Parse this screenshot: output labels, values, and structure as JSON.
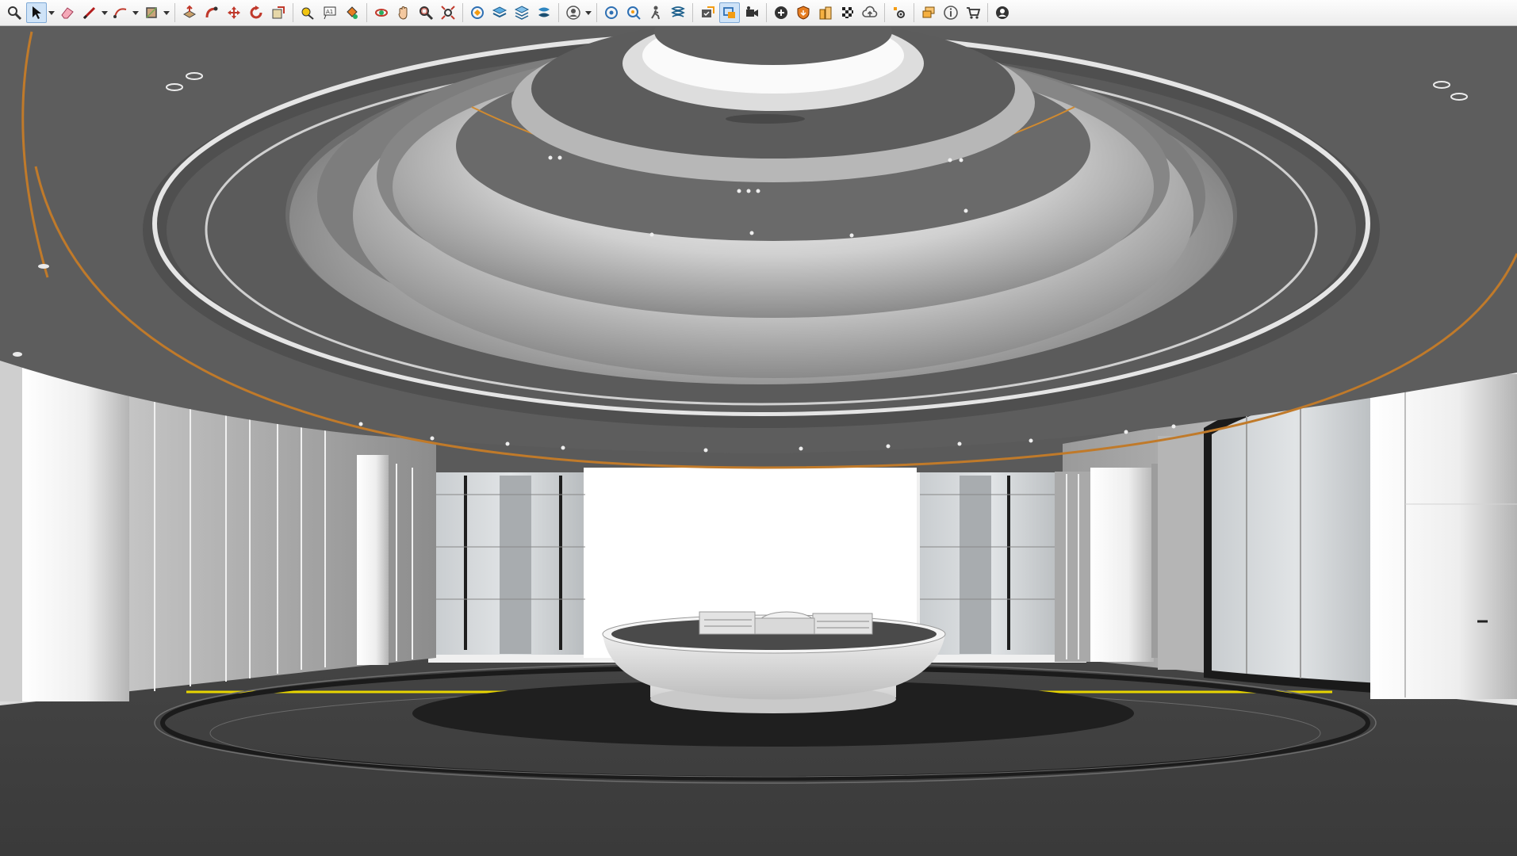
{
  "toolbar": {
    "groups": [
      [
        {
          "icon": "zoom-icon"
        },
        {
          "icon": "select-arrow-icon",
          "active": true,
          "caret": true
        },
        {
          "icon": "eraser-icon"
        },
        {
          "icon": "line-pencil-icon",
          "caret": true
        },
        {
          "icon": "arc-icon",
          "caret": true
        },
        {
          "icon": "rectangle-shape-icon",
          "caret": true
        }
      ],
      [
        {
          "icon": "push-pull-icon"
        },
        {
          "icon": "follow-me-icon"
        },
        {
          "icon": "move-icon"
        },
        {
          "icon": "rotate-icon"
        },
        {
          "icon": "scale-icon"
        }
      ],
      [
        {
          "icon": "tape-measure-icon"
        },
        {
          "icon": "text-label-icon"
        },
        {
          "icon": "paint-bucket-icon"
        }
      ],
      [
        {
          "icon": "orbit-icon"
        },
        {
          "icon": "pan-hand-icon"
        },
        {
          "icon": "zoom-window-icon"
        },
        {
          "icon": "zoom-extents-icon"
        }
      ],
      [
        {
          "icon": "section-plane-icon"
        },
        {
          "icon": "layers-stack-icon"
        },
        {
          "icon": "tags-layers-icon"
        },
        {
          "icon": "styles-icon"
        }
      ],
      [
        {
          "icon": "user-profile-icon",
          "caret": true
        }
      ],
      [
        {
          "icon": "camera-position-icon"
        },
        {
          "icon": "look-around-icon"
        },
        {
          "icon": "walk-icon"
        },
        {
          "icon": "scenes-icon"
        }
      ],
      [
        {
          "icon": "component-check-icon"
        },
        {
          "icon": "outliner-icon",
          "active": true
        },
        {
          "icon": "video-camera-icon"
        }
      ],
      [
        {
          "icon": "add-location-icon"
        },
        {
          "icon": "shield-warehouse-icon"
        },
        {
          "icon": "building-extension-icon"
        },
        {
          "icon": "checker-grid-icon"
        },
        {
          "icon": "cloud-upload-icon"
        }
      ],
      [
        {
          "icon": "extension-settings-icon"
        }
      ],
      [
        {
          "icon": "chat-bubble-icon"
        },
        {
          "icon": "info-icon"
        },
        {
          "icon": "cart-icon"
        }
      ],
      [
        {
          "icon": "account-avatar-icon"
        }
      ]
    ]
  },
  "colors": {
    "ceiling": "#5a5a5a",
    "floor": "#3c3c3c",
    "accent_orange": "#c07a2a",
    "accent_yellow": "#e8d500",
    "toolbar_bg": "#f2f2f2",
    "active_tool": "#cfe3f7"
  }
}
